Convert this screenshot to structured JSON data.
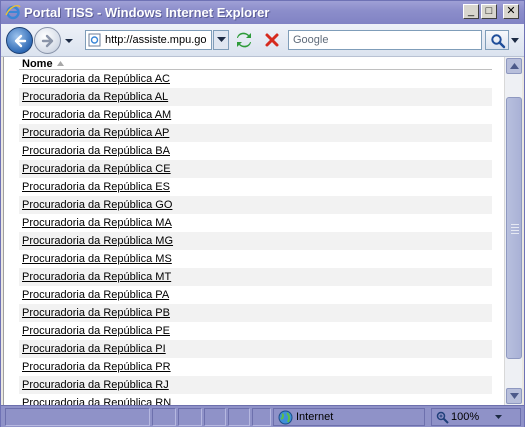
{
  "window": {
    "title": "Portal TISS - Windows Internet Explorer",
    "controls": {
      "minimize": "_",
      "maximize": "□",
      "close": "✕"
    }
  },
  "navbar": {
    "address": "http://assiste.mpu.go",
    "search_placeholder": "Google"
  },
  "table": {
    "header": "Nome",
    "sort": "ascending",
    "rows": [
      "Procuradoria da República AC",
      "Procuradoria da República AL",
      "Procuradoria da República AM",
      "Procuradoria da República AP",
      "Procuradoria da República BA",
      "Procuradoria da República CE",
      "Procuradoria da República ES",
      "Procuradoria da República GO",
      "Procuradoria da República MA",
      "Procuradoria da República MG",
      "Procuradoria da República MS",
      "Procuradoria da República MT",
      "Procuradoria da República PA",
      "Procuradoria da República PB",
      "Procuradoria da República PE",
      "Procuradoria da República PI",
      "Procuradoria da República PR",
      "Procuradoria da República RJ",
      "Procuradoria da República RN"
    ]
  },
  "statusbar": {
    "zone": "Internet",
    "zoom": "100%"
  },
  "colors": {
    "titlebar": "#8c8ecb",
    "statusbar": "#8f92c8",
    "row_alt": "#f2f2f2"
  }
}
